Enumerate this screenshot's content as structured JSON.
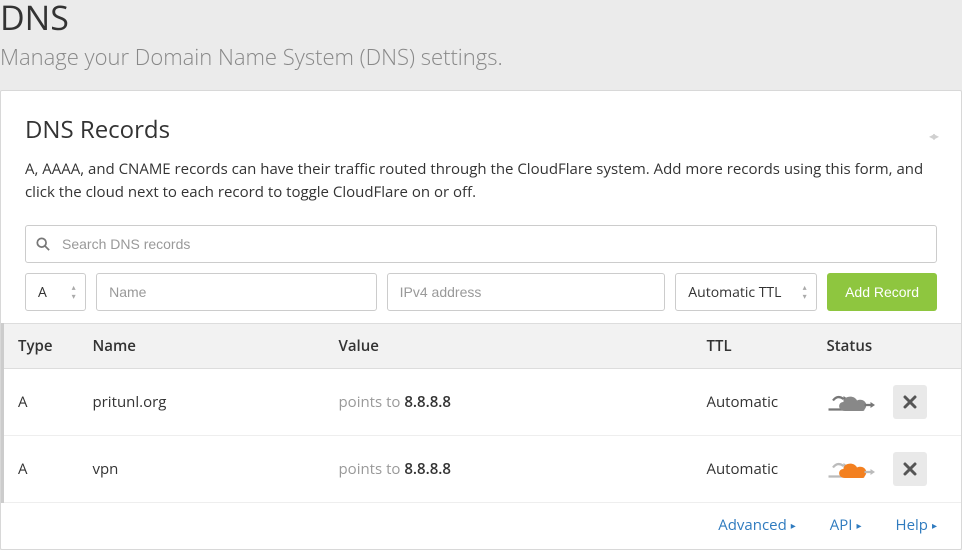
{
  "hero": {
    "title": "DNS",
    "subtitle": "Manage your Domain Name System (DNS) settings."
  },
  "panel": {
    "title": "DNS Records",
    "description": "A, AAAA, and CNAME records can have their traffic routed through the CloudFlare system. Add more records using this form, and click the cloud next to each record to toggle CloudFlare on or off."
  },
  "search": {
    "placeholder": "Search DNS records"
  },
  "add_form": {
    "type_value": "A",
    "name_placeholder": "Name",
    "value_placeholder": "IPv4 address",
    "ttl_value": "Automatic TTL",
    "add_button": "Add Record"
  },
  "table": {
    "headers": {
      "type": "Type",
      "name": "Name",
      "value": "Value",
      "ttl": "TTL",
      "status": "Status"
    },
    "value_prefix": "points to ",
    "rows": [
      {
        "type": "A",
        "name": "pritunl.org",
        "value": "8.8.8.8",
        "ttl": "Automatic",
        "cf_on": false
      },
      {
        "type": "A",
        "name": "vpn",
        "value": "8.8.8.8",
        "ttl": "Automatic",
        "cf_on": true
      }
    ]
  },
  "footer": {
    "advanced": "Advanced",
    "api": "API",
    "help": "Help"
  },
  "colors": {
    "accent_green": "#8ec63f",
    "link_blue": "#2f7bbf",
    "cloud_on": "#f38020",
    "cloud_off": "#888888"
  }
}
